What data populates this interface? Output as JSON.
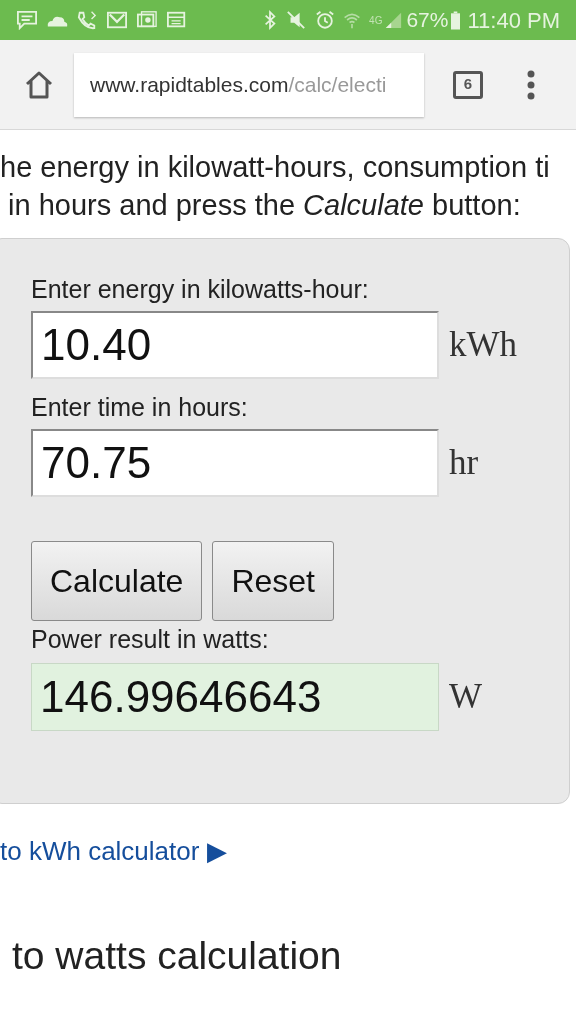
{
  "status_bar": {
    "network": "4G",
    "battery": "67%",
    "time": "11:40 PM"
  },
  "browser": {
    "url_host": "www.rapidtables.com",
    "url_path": "/calc/electi",
    "tab_count": "6"
  },
  "intro": [
    "he energy in kilowatt-hours, consumption ti",
    " in hours and press the *Calculate* button:"
  ],
  "calculator": {
    "fields": [
      {
        "label": "Enter energy in kilowatts-hour:",
        "value": "10.40",
        "unit": "kWh"
      },
      {
        "label": "Enter time in hours:",
        "value": "70.75",
        "unit": "hr"
      }
    ],
    "buttons": [
      "Calculate",
      "Reset"
    ],
    "result": {
      "label": "Power result in watts:",
      "value": "146.99646643",
      "unit": "W"
    }
  },
  "link": "to kWh calculator ▶",
  "heading": "to watts calculation"
}
